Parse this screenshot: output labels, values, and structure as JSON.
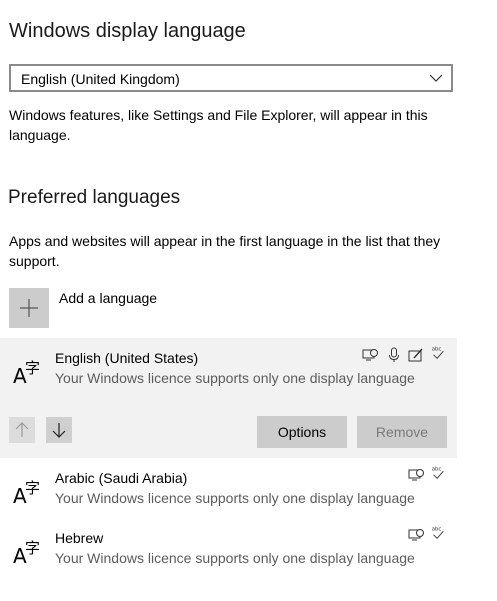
{
  "display_language": {
    "heading": "Windows display language",
    "selected": "English (United Kingdom)",
    "description": "Windows features, like Settings and File Explorer, will appear in this language."
  },
  "preferred_languages": {
    "heading": "Preferred languages",
    "description": "Apps and websites will appear in the first language in the list that they support.",
    "add_label": "Add a language",
    "options_label": "Options",
    "remove_label": "Remove",
    "languages": [
      {
        "name": "English (United States)",
        "note": "Your Windows licence supports only one display language",
        "features": [
          "display-language-icon",
          "speech-icon",
          "handwriting-icon",
          "spell-check-icon"
        ]
      },
      {
        "name": "Arabic (Saudi Arabia)",
        "note": "Your Windows licence supports only one display language",
        "features": [
          "display-language-icon",
          "spell-check-icon"
        ]
      },
      {
        "name": "Hebrew",
        "note": "Your Windows licence supports only one display language",
        "features": [
          "display-language-icon",
          "spell-check-icon"
        ]
      }
    ]
  },
  "icons": {
    "language_glyph": "A字",
    "spell_abc": "abc"
  },
  "colors": {
    "selected_row_bg": "#f2f2f2",
    "button_bg": "#cccccc",
    "disabled_text": "#7a7a7a",
    "sub_text": "#5c5c5c"
  }
}
